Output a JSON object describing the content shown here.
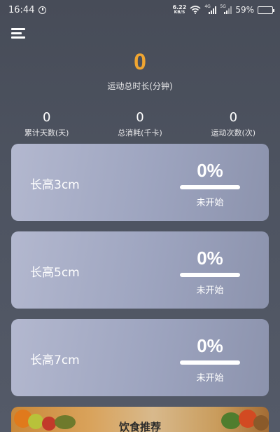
{
  "status_bar": {
    "time": "16:44",
    "speed_value": "6.22",
    "speed_unit": "KB/S",
    "signal_tag_1": "4G",
    "signal_tag_2": "5G",
    "battery": "59%"
  },
  "summary": {
    "total_minutes": "0",
    "total_label": "运动总时长(分钟)"
  },
  "stats": [
    {
      "value": "0",
      "label": "累计天数(天)"
    },
    {
      "value": "0",
      "label": "总消耗(千卡)"
    },
    {
      "value": "0",
      "label": "运动次数(次)"
    }
  ],
  "goals": [
    {
      "title": "长高3cm",
      "percent": "0%",
      "progress": 0,
      "status": "未开始"
    },
    {
      "title": "长高5cm",
      "percent": "0%",
      "progress": 0,
      "status": "未开始"
    },
    {
      "title": "长高7cm",
      "percent": "0%",
      "progress": 0,
      "status": "未开始"
    }
  ],
  "diet": {
    "title": "饮食推荐"
  },
  "colors": {
    "accent": "#f0a531",
    "card": "#a3a9c3",
    "background": "#4d5360"
  },
  "icons": [
    "alarm-icon",
    "wifi-icon",
    "signal-icon",
    "battery-icon",
    "menu-icon"
  ]
}
